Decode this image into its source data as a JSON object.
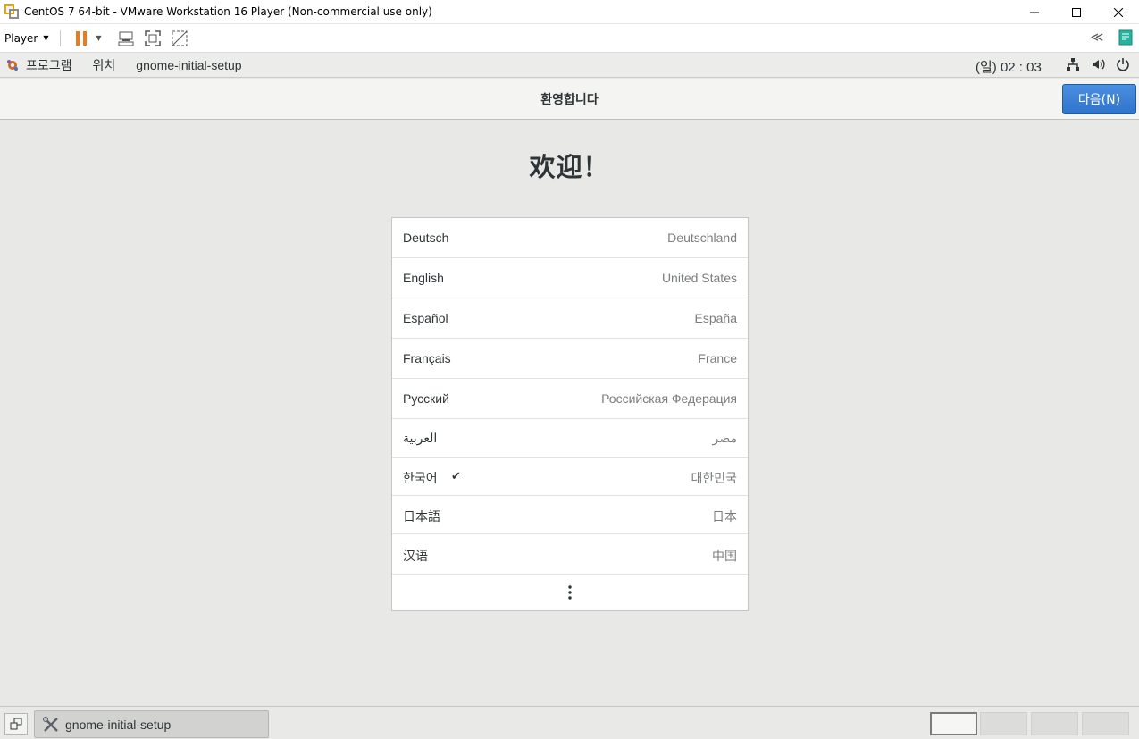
{
  "window": {
    "title": "CentOS 7 64-bit - VMware Workstation 16 Player (Non-commercial use only)"
  },
  "vm_toolbar": {
    "player_label": "Player"
  },
  "gnome_bar": {
    "apps_label": "프로그램",
    "places_label": "위치",
    "app_label": "gnome-initial-setup",
    "clock": "(일) 02 : 03"
  },
  "header": {
    "title": "환영합니다",
    "next_label": "다음(N)"
  },
  "welcome": "欢迎！",
  "languages": [
    {
      "name": "Deutsch",
      "country": "Deutschland",
      "selected": false
    },
    {
      "name": "English",
      "country": "United States",
      "selected": false
    },
    {
      "name": "Español",
      "country": "España",
      "selected": false
    },
    {
      "name": "Français",
      "country": "France",
      "selected": false
    },
    {
      "name": "Русский",
      "country": "Российская Федерация",
      "selected": false
    },
    {
      "name": "العربية",
      "country": "مصر",
      "selected": false
    },
    {
      "name": "한국어",
      "country": "대한민국",
      "selected": true
    },
    {
      "name": "日本語",
      "country": "日本",
      "selected": false
    },
    {
      "name": "汉语",
      "country": "中国",
      "selected": false
    }
  ],
  "check_mark": "✔",
  "taskbar": {
    "task_label": "gnome-initial-setup"
  },
  "colors": {
    "accent": "#3478d4",
    "pause": "#f07a1a"
  }
}
